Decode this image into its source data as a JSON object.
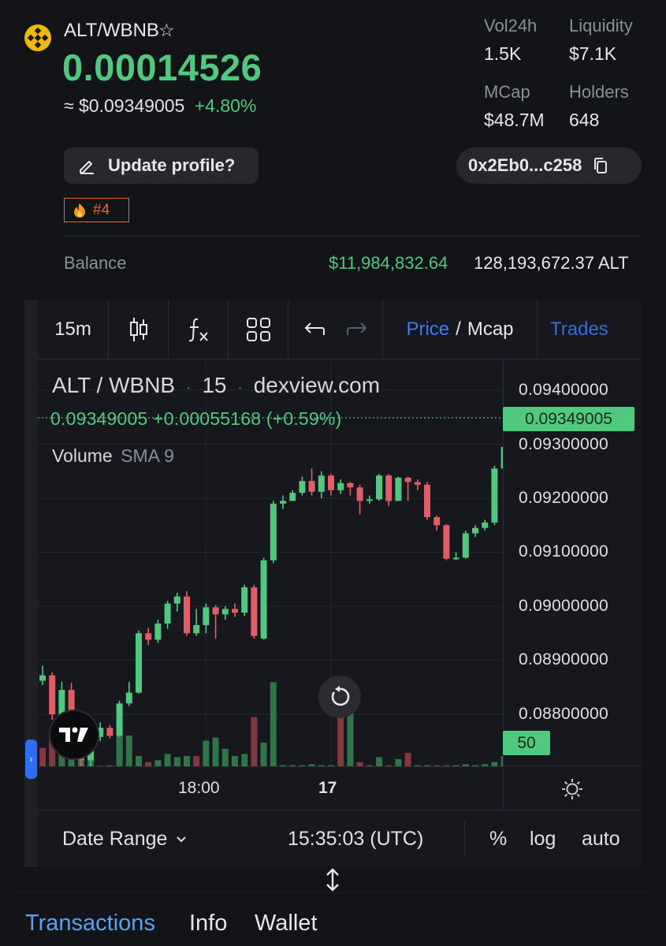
{
  "token": {
    "pair": "ALT/WBNB",
    "star_icon": "☆",
    "price": "0.00014526",
    "approx_symbol": "≈",
    "usd_price": "$0.09349005",
    "change": "+4.80%"
  },
  "stats": {
    "vol24h_label": "Vol24h",
    "vol24h_value": "1.5K",
    "liquidity_label": "Liquidity",
    "liquidity_value": "$7.1K",
    "mcap_label": "MCap",
    "mcap_value": "$48.7M",
    "holders_label": "Holders",
    "holders_value": "648"
  },
  "actions": {
    "update_profile": "Update profile?",
    "address": "0x2Eb0...c258",
    "rank": "#4"
  },
  "balance": {
    "label": "Balance",
    "usd": "$11,984,832.64",
    "tokens": "128,193,672.37 ALT"
  },
  "toolbar": {
    "interval": "15m",
    "price": "Price",
    "separator": "/",
    "mcap": "Mcap",
    "trades": "Trades"
  },
  "chart_legend": {
    "symbol": "ALT / WBNB",
    "interval": "15",
    "source": "dexview.com",
    "dot": "·",
    "last_value": "0.09349005",
    "last_change": "+0.00055168",
    "last_change_pct": "(+0.59%)",
    "volume_label": "Volume",
    "volume_study": "SMA 9"
  },
  "chart_tags": {
    "last_price": "0.09349005",
    "volume": "50"
  },
  "chart_footer": {
    "date_range": "Date Range",
    "time": "15:35:03 (UTC)",
    "percent": "%",
    "log": "log",
    "auto": "auto"
  },
  "bottom_tabs": [
    "Transactions",
    "Info",
    "Wallet"
  ],
  "colors": {
    "up": "#4fc97e",
    "down": "#e35d66",
    "accent": "#3b7cf6",
    "brand": "#efb90b"
  },
  "chart_data": {
    "type": "candlestick",
    "ylim": [
      0.0875,
      0.0945
    ],
    "yticks": [
      "0.09400000",
      "0.09300000",
      "0.09200000",
      "0.09100000",
      "0.09000000",
      "0.08900000",
      "0.08800000"
    ],
    "xticks": [
      {
        "label": "18:00",
        "index": 17,
        "bold": false
      },
      {
        "label": "17",
        "index": 30,
        "bold": true
      }
    ],
    "candles": [
      [
        0.08862,
        0.0889,
        0.08854,
        0.08872
      ],
      [
        0.08872,
        0.08878,
        0.0879,
        0.088
      ],
      [
        0.088,
        0.0886,
        0.0879,
        0.08845
      ],
      [
        0.08845,
        0.08858,
        0.0878,
        0.08785
      ],
      [
        0.08785,
        0.08793,
        0.087,
        0.08715
      ],
      [
        0.08715,
        0.08775,
        0.087,
        0.08765
      ],
      [
        0.08758,
        0.08785,
        0.0875,
        0.08775
      ],
      [
        0.08775,
        0.0878,
        0.08755,
        0.0876
      ],
      [
        0.0876,
        0.08825,
        0.08758,
        0.0882
      ],
      [
        0.0882,
        0.0886,
        0.08815,
        0.0884
      ],
      [
        0.0884,
        0.08955,
        0.08838,
        0.0895
      ],
      [
        0.0895,
        0.0896,
        0.08928,
        0.08938
      ],
      [
        0.08938,
        0.08975,
        0.08932,
        0.08968
      ],
      [
        0.08968,
        0.0901,
        0.08958,
        0.09005
      ],
      [
        0.09005,
        0.09025,
        0.0899,
        0.09018
      ],
      [
        0.09018,
        0.09028,
        0.08945,
        0.0895
      ],
      [
        0.0895,
        0.08995,
        0.08945,
        0.08965
      ],
      [
        0.08965,
        0.09005,
        0.0895,
        0.08998
      ],
      [
        0.08998,
        0.09002,
        0.0894,
        0.08985
      ],
      [
        0.08985,
        0.09,
        0.08975,
        0.08995
      ],
      [
        0.08995,
        0.09005,
        0.0898,
        0.08988
      ],
      [
        0.08988,
        0.0904,
        0.08982,
        0.09035
      ],
      [
        0.09035,
        0.0904,
        0.0894,
        0.08945
      ],
      [
        0.0894,
        0.0909,
        0.08938,
        0.09085
      ],
      [
        0.09085,
        0.09195,
        0.0908,
        0.0919
      ],
      [
        0.0919,
        0.09205,
        0.0918,
        0.09195
      ],
      [
        0.09195,
        0.09215,
        0.09195,
        0.0921
      ],
      [
        0.0921,
        0.0924,
        0.09205,
        0.09232
      ],
      [
        0.09232,
        0.09255,
        0.09205,
        0.09212
      ],
      [
        0.09212,
        0.0925,
        0.092,
        0.09242
      ],
      [
        0.09242,
        0.09245,
        0.09205,
        0.09215
      ],
      [
        0.09215,
        0.09235,
        0.09208,
        0.09228
      ],
      [
        0.09228,
        0.0923,
        0.09205,
        0.0922
      ],
      [
        0.0922,
        0.09225,
        0.0917,
        0.09195
      ],
      [
        0.09195,
        0.09205,
        0.0919,
        0.09198
      ],
      [
        0.09198,
        0.09245,
        0.09195,
        0.09242
      ],
      [
        0.09242,
        0.09245,
        0.09185,
        0.09195
      ],
      [
        0.09195,
        0.0924,
        0.09195,
        0.09238
      ],
      [
        0.09238,
        0.0924,
        0.09195,
        0.0923
      ],
      [
        0.0923,
        0.09235,
        0.09215,
        0.09225
      ],
      [
        0.09225,
        0.0923,
        0.0916,
        0.09165
      ],
      [
        0.09165,
        0.09168,
        0.0914,
        0.0915
      ],
      [
        0.0915,
        0.09152,
        0.09085,
        0.09088
      ],
      [
        0.09088,
        0.091,
        0.09085,
        0.0909
      ],
      [
        0.0909,
        0.0914,
        0.09088,
        0.09135
      ],
      [
        0.09135,
        0.0915,
        0.09128,
        0.09145
      ],
      [
        0.09145,
        0.0916,
        0.0914,
        0.09155
      ],
      [
        0.09155,
        0.0926,
        0.0915,
        0.09255
      ],
      [
        0.09255,
        0.09305,
        0.0925,
        0.09295
      ],
      [
        0.09295,
        0.09352,
        0.0929,
        0.09349
      ]
    ],
    "volume": [
      [
        18,
        "down"
      ],
      [
        35,
        "down"
      ],
      [
        46,
        "up"
      ],
      [
        18,
        "up"
      ],
      [
        30,
        "up"
      ],
      [
        35,
        "up"
      ],
      [
        0.5,
        "up"
      ],
      [
        1,
        "down"
      ],
      [
        42,
        "up"
      ],
      [
        30,
        "up"
      ],
      [
        10,
        "up"
      ],
      [
        4,
        "down"
      ],
      [
        6,
        "up"
      ],
      [
        12,
        "up"
      ],
      [
        9,
        "up"
      ],
      [
        10,
        "up"
      ],
      [
        10,
        "down"
      ],
      [
        25,
        "up"
      ],
      [
        28,
        "up"
      ],
      [
        17,
        "up"
      ],
      [
        10,
        "up"
      ],
      [
        12,
        "up"
      ],
      [
        48,
        "down"
      ],
      [
        23,
        "up"
      ],
      [
        82,
        "up"
      ],
      [
        1,
        "up"
      ],
      [
        1,
        "up"
      ],
      [
        1,
        "up"
      ],
      [
        2,
        "up"
      ],
      [
        1,
        "up"
      ],
      [
        1,
        "up"
      ],
      [
        73,
        "down"
      ],
      [
        54,
        "up"
      ],
      [
        4,
        "down"
      ],
      [
        1,
        "up"
      ],
      [
        9,
        "up"
      ],
      [
        1,
        "down"
      ],
      [
        7,
        "up"
      ],
      [
        13,
        "down"
      ],
      [
        1,
        "up"
      ],
      [
        1,
        "up"
      ],
      [
        1,
        "down"
      ],
      [
        1,
        "down"
      ],
      [
        1,
        "up"
      ],
      [
        2,
        "up"
      ],
      [
        1,
        "up"
      ],
      [
        2,
        "up"
      ],
      [
        4,
        "up"
      ],
      [
        10,
        "up"
      ],
      [
        15,
        "up"
      ]
    ]
  }
}
